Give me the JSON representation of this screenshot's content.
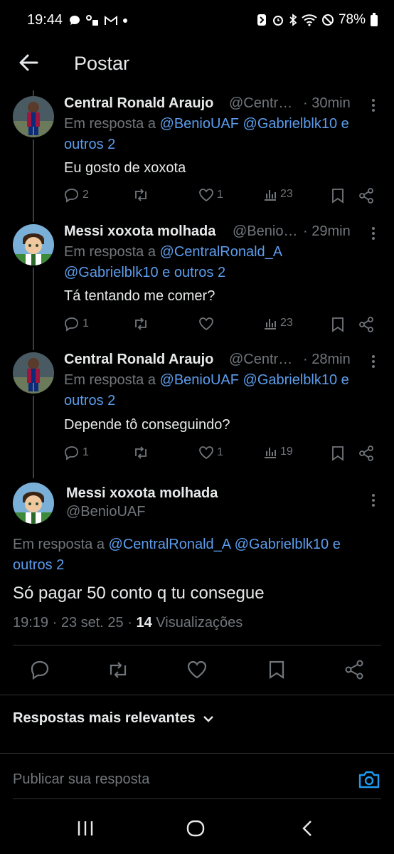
{
  "status_bar": {
    "time": "19:44",
    "battery": "78%"
  },
  "header": {
    "title": "Postar"
  },
  "replies": [
    {
      "name": "Central Ronald Araujo",
      "handle": "@Centr…",
      "time": "· 30min",
      "reply_prefix": "Em resposta a",
      "reply_mentions": "@BenioUAF @Gabrielblk10 e",
      "reply_suffix": "outros 2",
      "text": "Eu gosto de xoxota",
      "replies": "2",
      "retweets": "",
      "likes": "1",
      "views": "23"
    },
    {
      "name": "Messi xoxota molhada",
      "handle": "@Benio…",
      "time": "· 29min",
      "reply_prefix": "Em resposta a",
      "reply_mentions": "@CentralRonald_A",
      "reply_suffix": "@Gabrielblk10 e outros 2",
      "text": "Tá tentando me comer?",
      "replies": "1",
      "retweets": "",
      "likes": "",
      "views": "23"
    },
    {
      "name": "Central Ronald Araujo",
      "handle": "@Centr…",
      "time": "· 28min",
      "reply_prefix": "Em resposta a",
      "reply_mentions": "@BenioUAF @Gabrielblk10 e",
      "reply_suffix": "outros 2",
      "text": "Depende tô conseguindo?",
      "replies": "1",
      "retweets": "",
      "likes": "1",
      "views": "19"
    }
  ],
  "main_post": {
    "name": "Messi xoxota molhada",
    "handle": "@BenioUAF",
    "reply_prefix": "Em resposta a",
    "reply_mentions": "@CentralRonald_A @Gabrielblk10 e",
    "reply_suffix": "outros 2",
    "text": "Só pagar 50 conto q tu consegue",
    "meta_time": "19:19 · 23 set. 25 ·",
    "views_count": "14",
    "views_label": "Visualizações"
  },
  "sort": {
    "label": "Respostas mais relevantes"
  },
  "compose": {
    "placeholder": "Publicar sua resposta"
  },
  "colors": {
    "accent": "#1d9bf0",
    "mention": "#5c9ded",
    "muted": "#71767b"
  }
}
